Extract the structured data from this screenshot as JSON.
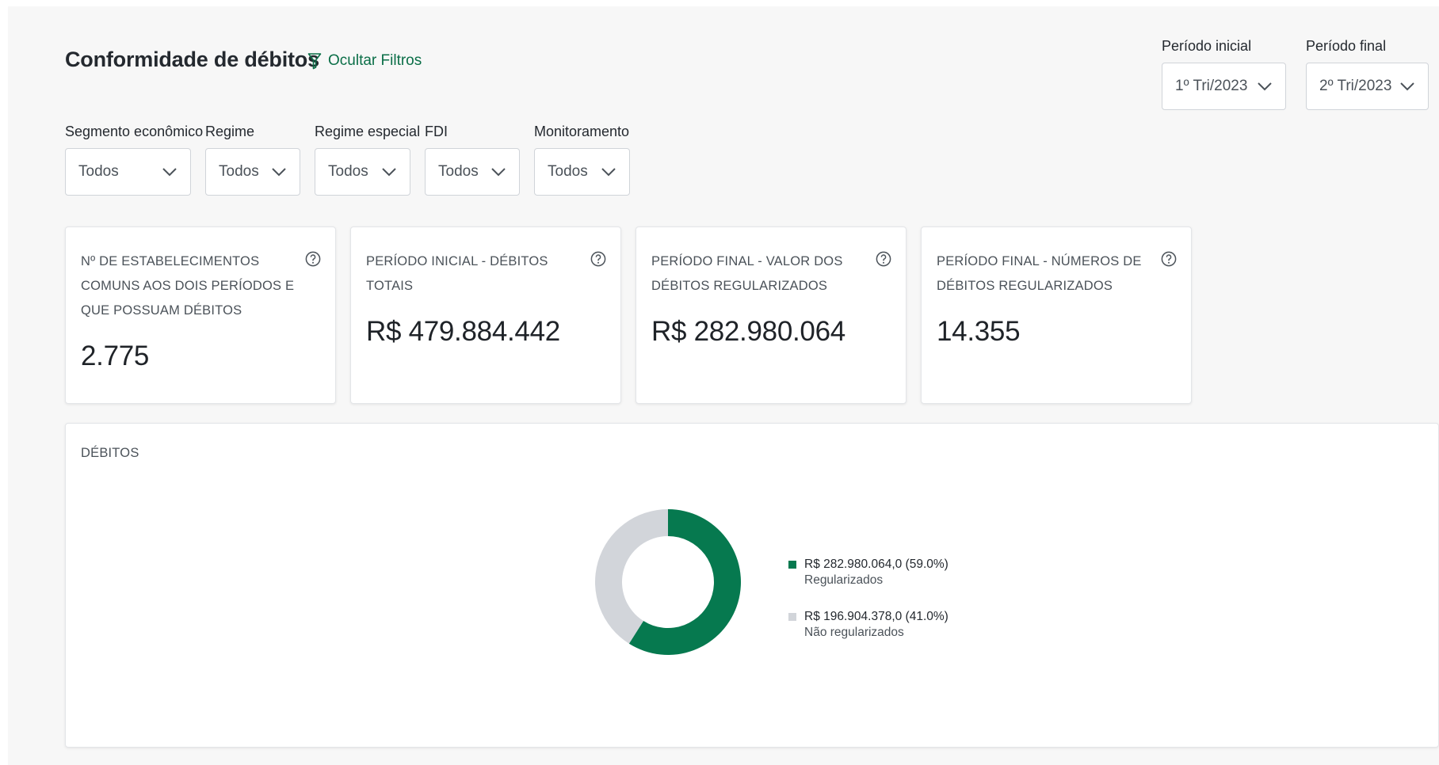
{
  "header": {
    "title": "Conformidade de débitos",
    "hide_filters_label": "Ocultar Filtros"
  },
  "period": {
    "initial": {
      "label": "Período inicial",
      "value": "1º Tri/2023"
    },
    "final": {
      "label": "Período final",
      "value": "2º Tri/2023"
    }
  },
  "filters": [
    {
      "label": "Segmento econômico",
      "value": "Todos"
    },
    {
      "label": "Regime",
      "value": "Todos"
    },
    {
      "label": "Regime especial",
      "value": "Todos"
    },
    {
      "label": "FDI",
      "value": "Todos"
    },
    {
      "label": "Monitoramento",
      "value": "Todos"
    }
  ],
  "kpis": [
    {
      "label": "Nº de estabelecimentos comuns aos dois períodos e que possuam débitos",
      "value": "2.775"
    },
    {
      "label": "Período inicial - Débitos totais",
      "value": "R$ 479.884.442"
    },
    {
      "label": "Período final - Valor dos débitos regularizados",
      "value": "R$ 282.980.064"
    },
    {
      "label": "Período final - Números de débitos regularizados",
      "value": "14.355"
    }
  ],
  "chart_card": {
    "title": "Débitos"
  },
  "colors": {
    "accent": "#0a6e47",
    "regularized": "#06794f",
    "not_regularized": "#d2d5da"
  },
  "chart_data": {
    "type": "pie",
    "donut": true,
    "title": "Débitos",
    "slices": [
      {
        "name": "Regularizados",
        "value": 282980064.0,
        "percent": 59.0,
        "label": "R$ 282.980.064,0 (59.0%)",
        "color": "#06794f"
      },
      {
        "name": "Não regularizados",
        "value": 196904378.0,
        "percent": 41.0,
        "label": "R$ 196.904.378,0 (41.0%)",
        "color": "#d2d5da"
      }
    ],
    "legend": "right"
  }
}
